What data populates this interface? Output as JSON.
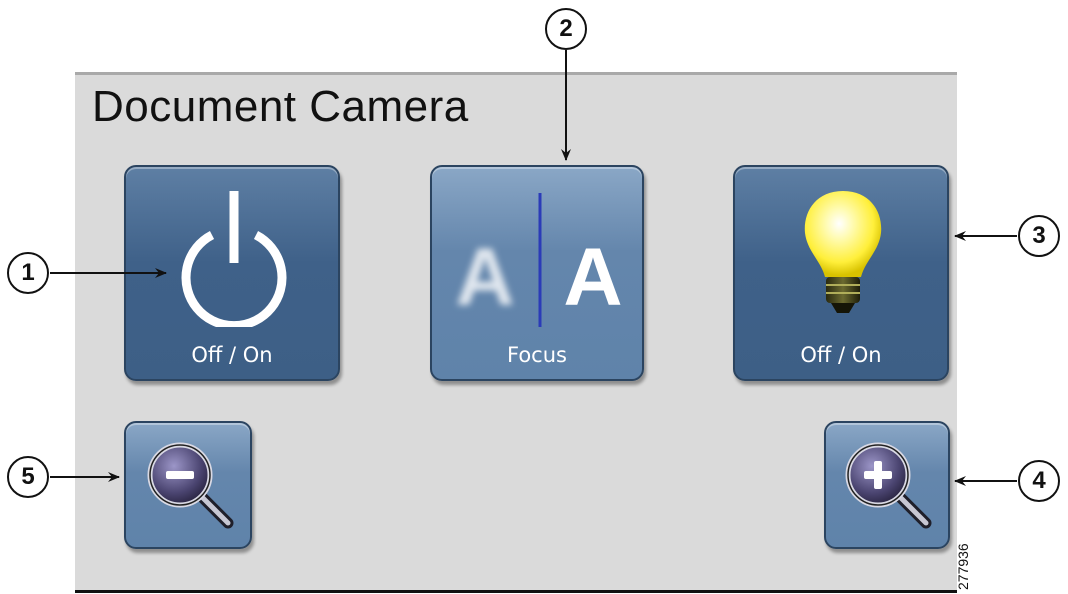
{
  "panel": {
    "title": "Document Camera"
  },
  "buttons": {
    "power": {
      "label": "Off / On",
      "icon": "power-icon"
    },
    "focus": {
      "label": "Focus",
      "icon": "focus-icon",
      "letter_blur": "A",
      "letter_sharp": "A"
    },
    "light": {
      "label": "Off / On",
      "icon": "lightbulb-icon"
    },
    "zoom_out": {
      "icon": "zoom-out-icon"
    },
    "zoom_in": {
      "icon": "zoom-in-icon"
    }
  },
  "callouts": [
    "1",
    "2",
    "3",
    "4",
    "5"
  ],
  "figure_id": "277936",
  "colors": {
    "panel_bg": "#dadada",
    "button_dark": "#3f6189",
    "button_light": "#6486ac",
    "bulb_glow": "#ffff66"
  }
}
